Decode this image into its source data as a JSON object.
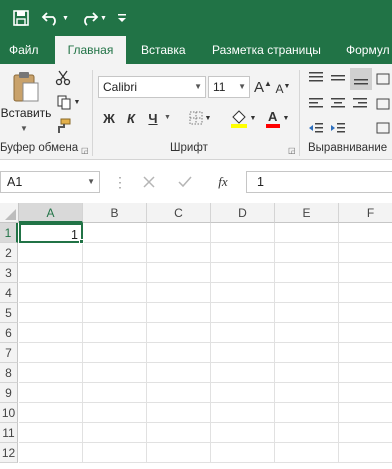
{
  "qat": {
    "save_icon": "save-icon",
    "undo_icon": "undo-icon",
    "redo_icon": "redo-icon",
    "customize_icon": "customize-qat-icon"
  },
  "tabs": [
    "Файл",
    "Главная",
    "Вставка",
    "Разметка страницы",
    "Формул"
  ],
  "clipboard": {
    "paste_label": "Вставить",
    "group_label": "Буфер обмена"
  },
  "font": {
    "name": "Calibri",
    "size": "11",
    "bold": "Ж",
    "italic": "К",
    "underline": "Ч",
    "group_label": "Шрифт",
    "grow": "A",
    "shrink": "A"
  },
  "alignment": {
    "group_label": "Выравнивание"
  },
  "formula_bar": {
    "name_box": "A1",
    "fx": "fx",
    "value": "1"
  },
  "sheet": {
    "columns": [
      "A",
      "B",
      "C",
      "D",
      "E",
      "F"
    ],
    "rows": [
      "1",
      "2",
      "3",
      "4",
      "5",
      "6",
      "7",
      "8",
      "9",
      "10",
      "11",
      "12"
    ],
    "active_cell": "A1",
    "cells": {
      "A1": "1"
    }
  },
  "colors": {
    "excel_green": "#217346",
    "highlight": "#ffff00",
    "font_color": "#ff0000"
  }
}
